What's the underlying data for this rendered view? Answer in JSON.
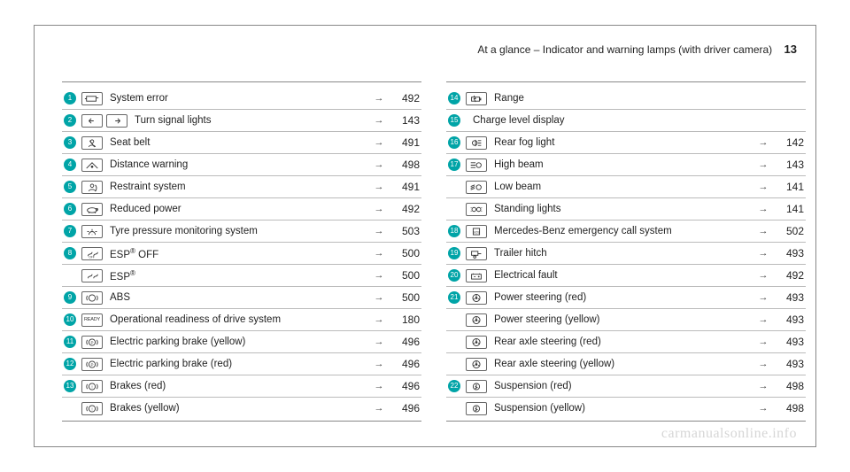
{
  "header": {
    "title": "At a glance – Indicator and warning lamps (with driver camera)",
    "page_number": "13"
  },
  "watermark": "carmanualsonline.info",
  "arrow_glyph": "→",
  "left": [
    {
      "num": "1",
      "icons": [
        "engine"
      ],
      "label": "System error",
      "page": "492"
    },
    {
      "num": "2",
      "icons": [
        "turnL",
        "turnR"
      ],
      "label": "Turn signal lights",
      "page": "143"
    },
    {
      "num": "3",
      "icons": [
        "seatbelt"
      ],
      "label": "Seat belt",
      "page": "491"
    },
    {
      "num": "4",
      "icons": [
        "distance"
      ],
      "label": "Distance warning",
      "page": "498"
    },
    {
      "num": "5",
      "icons": [
        "restraint"
      ],
      "label": "Restraint system",
      "page": "491"
    },
    {
      "num": "6",
      "icons": [
        "turtle"
      ],
      "label": "Reduced power",
      "page": "492"
    },
    {
      "num": "7",
      "icons": [
        "tyre"
      ],
      "label": "Tyre pressure monitoring system",
      "page": "503"
    },
    {
      "num": "8",
      "icons": [
        "espoff"
      ],
      "label_html": "ESP<sup>®</sup> OFF",
      "page": "500"
    },
    {
      "num": "",
      "icons": [
        "esp"
      ],
      "label_html": "ESP<sup>®</sup>",
      "page": "500"
    },
    {
      "num": "9",
      "icons": [
        "abs"
      ],
      "label": "ABS",
      "page": "500"
    },
    {
      "num": "10",
      "icons": [
        "ready"
      ],
      "label": "Operational readiness of drive system",
      "page": "180"
    },
    {
      "num": "11",
      "icons": [
        "pbrake"
      ],
      "label": "Electric parking brake (yellow)",
      "page": "496"
    },
    {
      "num": "12",
      "icons": [
        "pbrake"
      ],
      "label": "Electric parking brake (red)",
      "page": "496"
    },
    {
      "num": "13",
      "icons": [
        "brake"
      ],
      "label": "Brakes (red)",
      "page": "496"
    },
    {
      "num": "",
      "icons": [
        "brake"
      ],
      "label": "Brakes (yellow)",
      "page": "496"
    }
  ],
  "right": [
    {
      "num": "14",
      "icons": [
        "range"
      ],
      "label": "Range",
      "page": ""
    },
    {
      "num": "15",
      "icons": [],
      "label": "Charge level display",
      "page": ""
    },
    {
      "num": "16",
      "icons": [
        "fog"
      ],
      "label": "Rear fog light",
      "page": "142"
    },
    {
      "num": "17",
      "icons": [
        "highbeam"
      ],
      "label": "High beam",
      "page": "143"
    },
    {
      "num": "",
      "icons": [
        "lowbeam"
      ],
      "label": "Low beam",
      "page": "141"
    },
    {
      "num": "",
      "icons": [
        "standing"
      ],
      "label": "Standing lights",
      "page": "141"
    },
    {
      "num": "18",
      "icons": [
        "sos"
      ],
      "label": "Mercedes-Benz emergency call system",
      "page": "502"
    },
    {
      "num": "19",
      "icons": [
        "trailer"
      ],
      "label": "Trailer hitch",
      "page": "493"
    },
    {
      "num": "20",
      "icons": [
        "battery"
      ],
      "label": "Electrical fault",
      "page": "492"
    },
    {
      "num": "21",
      "icons": [
        "steering"
      ],
      "label": "Power steering (red)",
      "page": "493"
    },
    {
      "num": "",
      "icons": [
        "steering"
      ],
      "label": "Power steering (yellow)",
      "page": "493"
    },
    {
      "num": "",
      "icons": [
        "steering"
      ],
      "label": "Rear axle steering (red)",
      "page": "493"
    },
    {
      "num": "",
      "icons": [
        "steering"
      ],
      "label": "Rear axle steering (yellow)",
      "page": "493"
    },
    {
      "num": "22",
      "icons": [
        "suspension"
      ],
      "label": "Suspension (red)",
      "page": "498"
    },
    {
      "num": "",
      "icons": [
        "suspension"
      ],
      "label": "Suspension (yellow)",
      "page": "498"
    }
  ]
}
